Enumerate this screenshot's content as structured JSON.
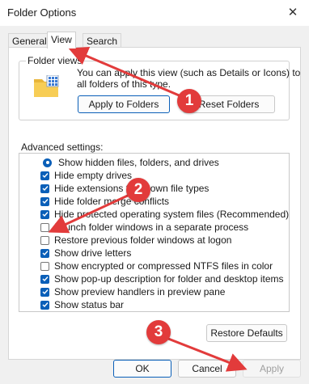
{
  "window": {
    "title": "Folder Options",
    "close_glyph": "✕"
  },
  "tabs": [
    {
      "label": "General",
      "active": false
    },
    {
      "label": "View",
      "active": true
    },
    {
      "label": "Search",
      "active": false
    }
  ],
  "folder_views": {
    "label": "Folder views",
    "description_line1": "You can apply this view (such as Details or Icons) to",
    "description_line2": "all folders of this type.",
    "apply_button": "Apply to Folders",
    "reset_button": "Reset Folders",
    "icon": "folder-icon"
  },
  "advanced": {
    "label": "Advanced settings:",
    "items": [
      {
        "type": "radio",
        "label": "Show hidden files, folders, and drives",
        "checked": true
      },
      {
        "type": "checkbox",
        "label": "Hide empty drives",
        "checked": true
      },
      {
        "type": "checkbox",
        "label": "Hide extensions for known file types",
        "checked": true
      },
      {
        "type": "checkbox",
        "label": "Hide folder merge conflicts",
        "checked": true
      },
      {
        "type": "checkbox",
        "label": "Hide protected operating system files (Recommended)",
        "checked": true
      },
      {
        "type": "checkbox",
        "label": "Launch folder windows in a separate process",
        "checked": false
      },
      {
        "type": "checkbox",
        "label": "Restore previous folder windows at logon",
        "checked": false
      },
      {
        "type": "checkbox",
        "label": "Show drive letters",
        "checked": true
      },
      {
        "type": "checkbox",
        "label": "Show encrypted or compressed NTFS files in color",
        "checked": false
      },
      {
        "type": "checkbox",
        "label": "Show pop-up description for folder and desktop items",
        "checked": true
      },
      {
        "type": "checkbox",
        "label": "Show preview handlers in preview pane",
        "checked": true
      },
      {
        "type": "checkbox",
        "label": "Show status bar",
        "checked": true
      }
    ]
  },
  "restore_defaults": "Restore Defaults",
  "footer": {
    "ok": "OK",
    "cancel": "Cancel",
    "apply": "Apply"
  },
  "callouts": [
    "1",
    "2",
    "3"
  ],
  "colors": {
    "accent": "#0a5fb8",
    "callout": "#e23b3b"
  }
}
